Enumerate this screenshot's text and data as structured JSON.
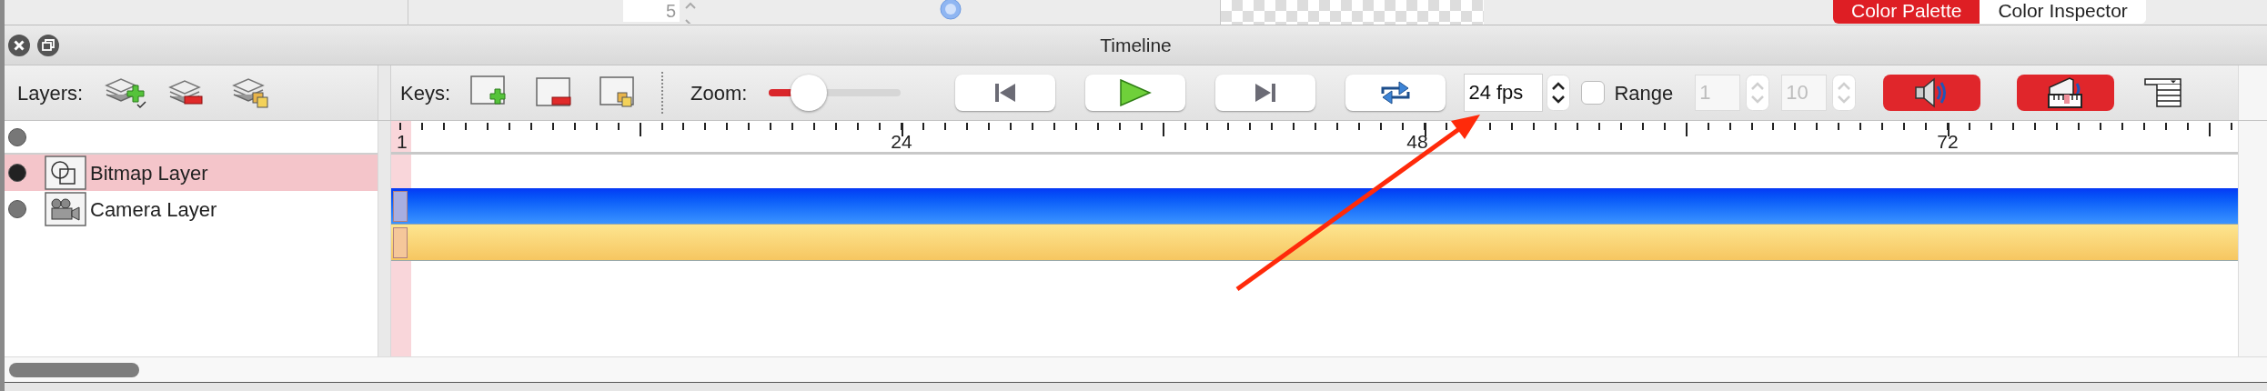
{
  "background_panels": {
    "spinner_value": "5",
    "tabs": [
      {
        "label": "Color Palette",
        "selected": true
      },
      {
        "label": "Color Inspector",
        "selected": false
      }
    ]
  },
  "window": {
    "title": "Timeline"
  },
  "layers_toolbar": {
    "label": "Layers:"
  },
  "keys_toolbar": {
    "label": "Keys:",
    "zoom_label": "Zoom:",
    "zoom": {
      "level": 0.3
    }
  },
  "fps": {
    "value": "24 fps"
  },
  "range": {
    "label": "Range",
    "checked": false,
    "start": "1",
    "end": "10",
    "disabled": true
  },
  "ruler": {
    "labels": [
      "1",
      "24",
      "48",
      "72"
    ]
  },
  "layers": [
    {
      "kind": "root",
      "selected": false
    },
    {
      "kind": "bitmap",
      "name": "Bitmap Layer",
      "selected": true
    },
    {
      "kind": "camera",
      "name": "Camera Layer",
      "selected": false
    }
  ]
}
